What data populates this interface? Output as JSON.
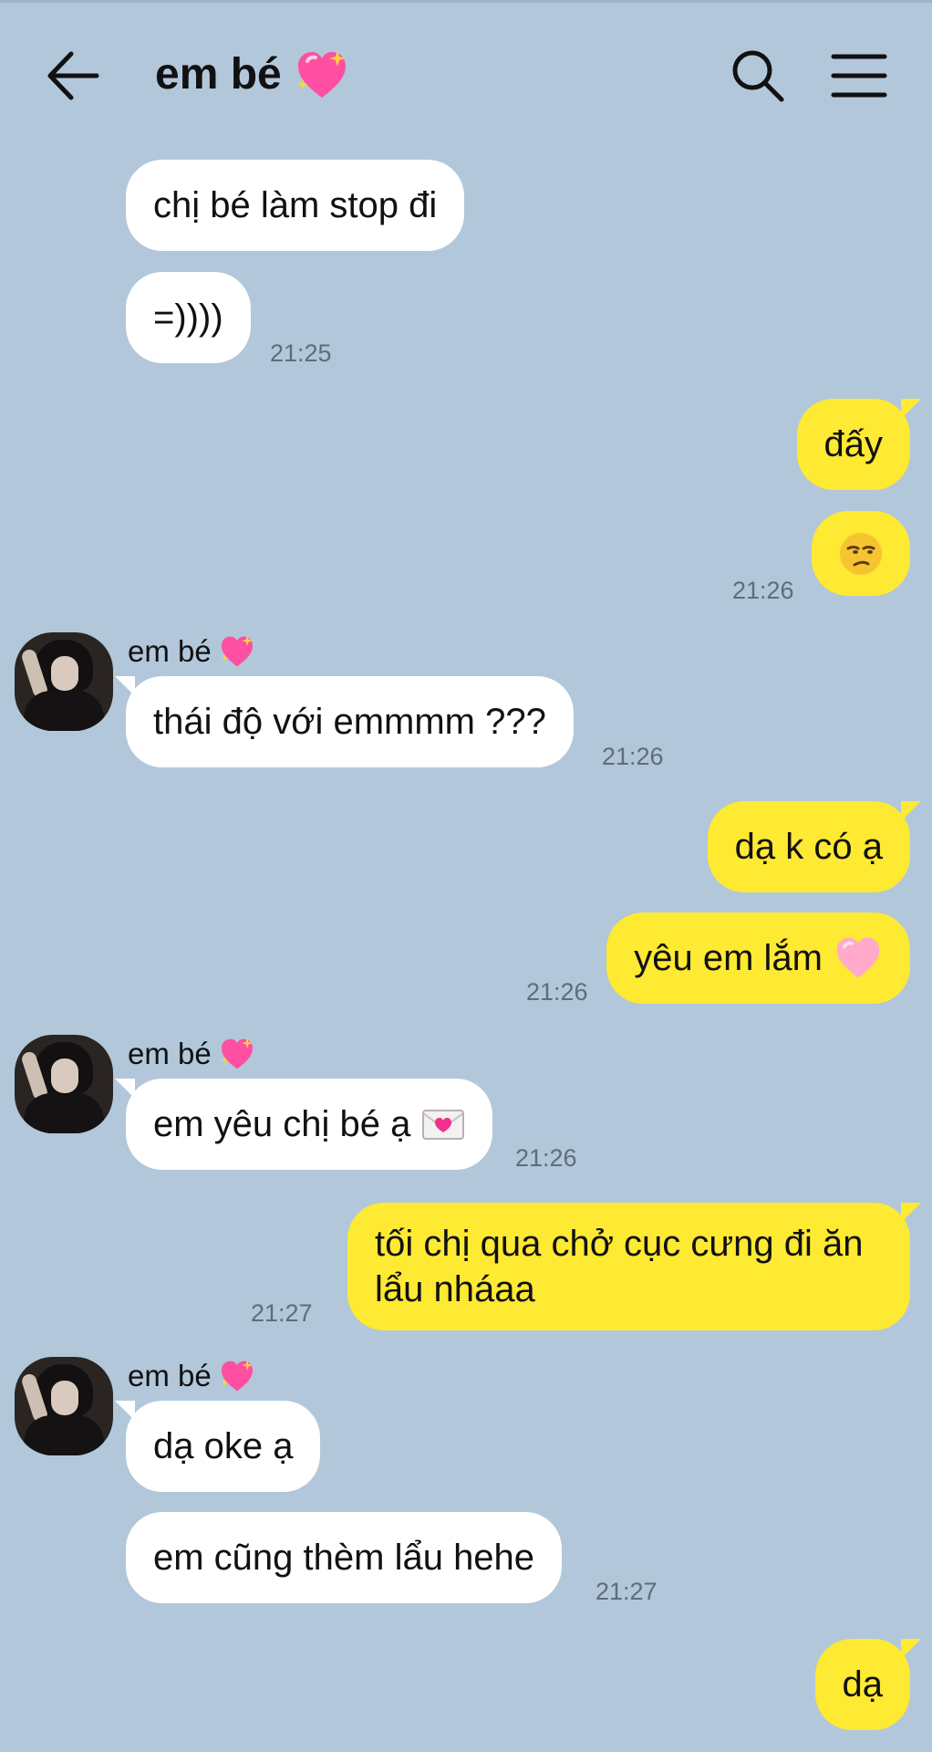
{
  "header": {
    "title": "em bé",
    "back_icon": "back-arrow-icon",
    "title_icon": "sparkling-heart-icon",
    "search_icon": "search-icon",
    "menu_icon": "menu-icon"
  },
  "contact": {
    "name": "em bé",
    "avatar": "avatar-photo"
  },
  "messages": [
    {
      "from": "them",
      "text": "chị bé làm stop đi"
    },
    {
      "from": "them",
      "text": "=))))",
      "time": "21:25"
    },
    {
      "from": "me",
      "text": "đấy"
    },
    {
      "from": "me",
      "emoji": "unamused-face",
      "time": "21:26"
    },
    {
      "from": "them",
      "sender": "em bé",
      "text": "thái độ với emmmm ???",
      "time": "21:26"
    },
    {
      "from": "me",
      "text": "dạ k có ạ"
    },
    {
      "from": "me",
      "text": "yêu em lắm",
      "emoji": "pink-heart",
      "time": "21:26"
    },
    {
      "from": "them",
      "sender": "em bé",
      "text": "em yêu chị bé ạ",
      "emoji": "love-letter",
      "time": "21:26"
    },
    {
      "from": "me",
      "lines": [
        "tối chị qua chở cục cưng đi ăn",
        "lẩu nháaa"
      ],
      "time": "21:27"
    },
    {
      "from": "them",
      "sender": "em bé",
      "text": "dạ oke ạ"
    },
    {
      "from": "them",
      "text": "em cũng thèm lẩu hehe",
      "time": "21:27"
    },
    {
      "from": "me",
      "text": "dạ"
    }
  ],
  "colors": {
    "background": "#b2c7da",
    "sent_bubble": "#fee933",
    "received_bubble": "#ffffff",
    "timestamp": "#5f6d7b"
  }
}
